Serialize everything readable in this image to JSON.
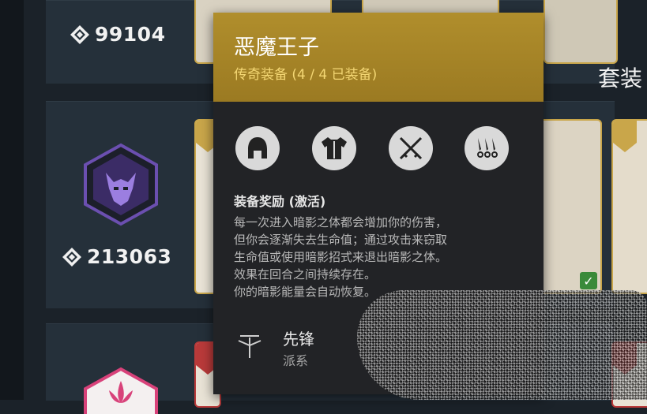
{
  "sets": [
    {
      "power": "99104",
      "emblem_icon": "faded-emblem-icon"
    },
    {
      "power": "213063",
      "emblem_icon": "demon-emblem-icon",
      "accent": "#6b4fb0"
    },
    {
      "power": "",
      "emblem_icon": "lotus-emblem-icon",
      "accent": "#d8427a"
    }
  ],
  "side_title": "套装",
  "tooltip": {
    "name": "恶魔王子",
    "subtitle": "传奇装备 (4 / 4 已装备)",
    "slots": [
      "helmet-icon",
      "chest-armor-icon",
      "crossed-swords-icon",
      "kunai-icon"
    ],
    "bonus_title": "装备奖励 (激活)",
    "description": [
      "每一次进入暗影之体都会增加你的伤害，",
      "但你会逐渐失去生命值；通过攻击来窃取",
      "生命值或使用暗影招式来退出暗影之体。",
      "效果在回合之间持续存在。",
      "你的暗影能量会自动恢复。"
    ],
    "class_name": "先锋",
    "class_type": "派系"
  },
  "colors": {
    "gold": "#b08e2c",
    "subtitle": "#f4d774",
    "equipped": "#3a8a3a"
  }
}
